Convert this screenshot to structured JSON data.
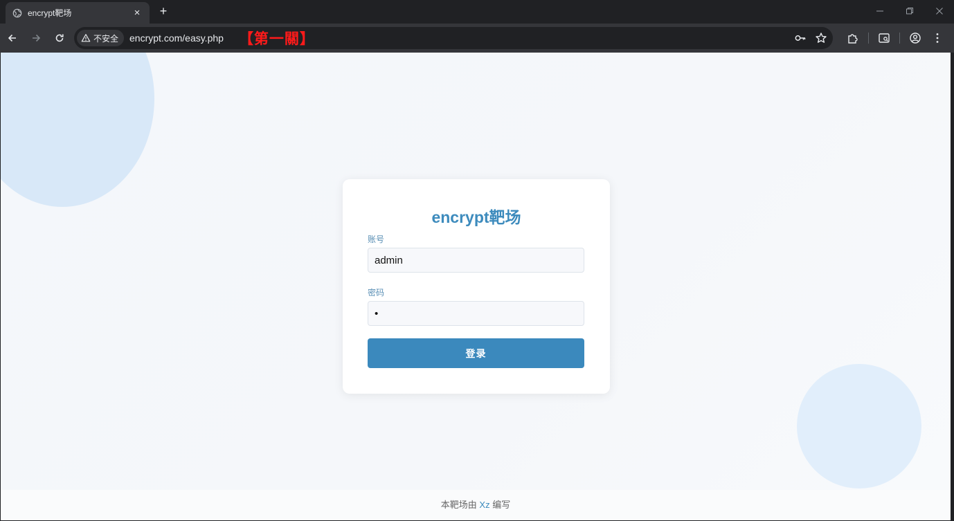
{
  "browser": {
    "tab_title": "encrypt靶场",
    "close_glyph": "×",
    "new_tab_glyph": "+",
    "security_label": "不安全",
    "url": "encrypt.com/easy.php",
    "annotation": "【第一關】"
  },
  "login": {
    "title": "encrypt靶场",
    "username_label": "账号",
    "username_value": "admin",
    "password_label": "密码",
    "password_value": "•",
    "submit_label": "登录"
  },
  "footer": {
    "prefix": "本靶场由 ",
    "author": "Xz",
    "suffix": " 编写"
  },
  "colors": {
    "accent": "#3b89bd",
    "annotation": "#ff1a1a"
  }
}
